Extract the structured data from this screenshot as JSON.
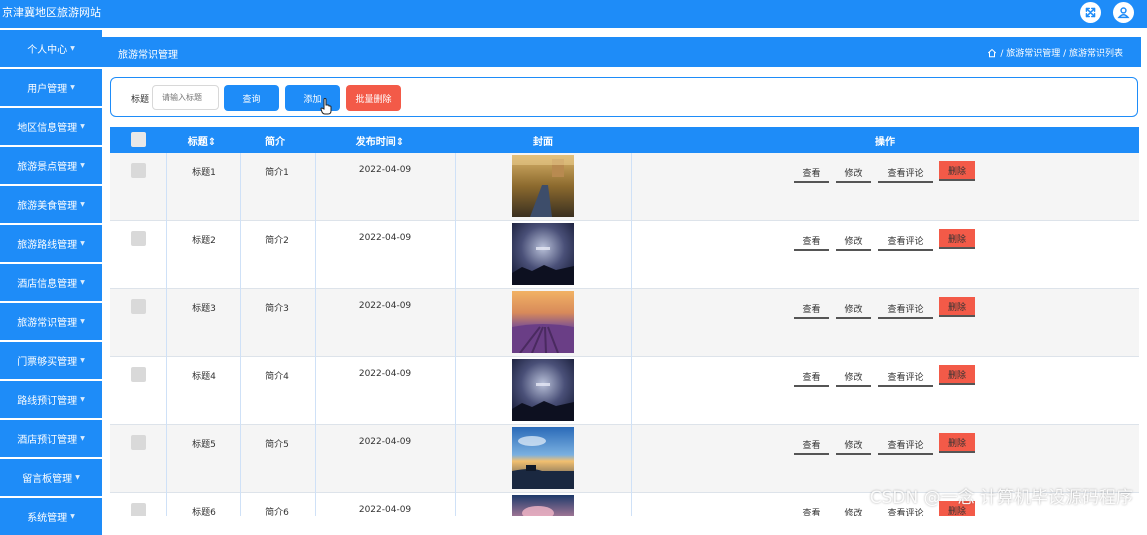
{
  "app": {
    "title": "京津冀地区旅游网站"
  },
  "topbar": {
    "icons": [
      "fullscreen-icon",
      "user-icon"
    ]
  },
  "sidebar": {
    "items": [
      {
        "label": "个人中心"
      },
      {
        "label": "用户管理"
      },
      {
        "label": "地区信息管理"
      },
      {
        "label": "旅游景点管理"
      },
      {
        "label": "旅游美食管理"
      },
      {
        "label": "旅游路线管理"
      },
      {
        "label": "酒店信息管理"
      },
      {
        "label": "旅游常识管理"
      },
      {
        "label": "门票够买管理"
      },
      {
        "label": "路线预订管理"
      },
      {
        "label": "酒店预订管理"
      },
      {
        "label": "留言板管理"
      },
      {
        "label": "系统管理"
      }
    ]
  },
  "header": {
    "title": "旅游常识管理",
    "breadcrumb": "/ 旅游常识管理 / 旅游常识列表"
  },
  "search": {
    "label": "标题",
    "placeholder": "请输入标题",
    "query_label": "查询",
    "add_label": "添加",
    "batch_delete_label": "批量删除"
  },
  "table": {
    "columns": [
      "标题⇕",
      "简介",
      "发布时间⇕",
      "封面",
      "操作"
    ],
    "rows": [
      {
        "title": "标题1",
        "intro": "简介1",
        "date": "2022-04-09",
        "cover": "road"
      },
      {
        "title": "标题2",
        "intro": "简介2",
        "date": "2022-04-09",
        "cover": "night"
      },
      {
        "title": "标题3",
        "intro": "简介3",
        "date": "2022-04-09",
        "cover": "lavender"
      },
      {
        "title": "标题4",
        "intro": "简介4",
        "date": "2022-04-09",
        "cover": "night"
      },
      {
        "title": "标题5",
        "intro": "简介5",
        "date": "2022-04-09",
        "cover": "lake"
      },
      {
        "title": "标题6",
        "intro": "简介6",
        "date": "2022-04-09",
        "cover": "pink"
      }
    ],
    "actions": {
      "view": "查看",
      "edit": "修改",
      "comments": "查看评论",
      "delete": "删除"
    }
  },
  "watermark": "CSDN @一念 计算机毕设源码程序",
  "colors": {
    "primary": "#1e8cf8",
    "danger": "#f35a48"
  }
}
